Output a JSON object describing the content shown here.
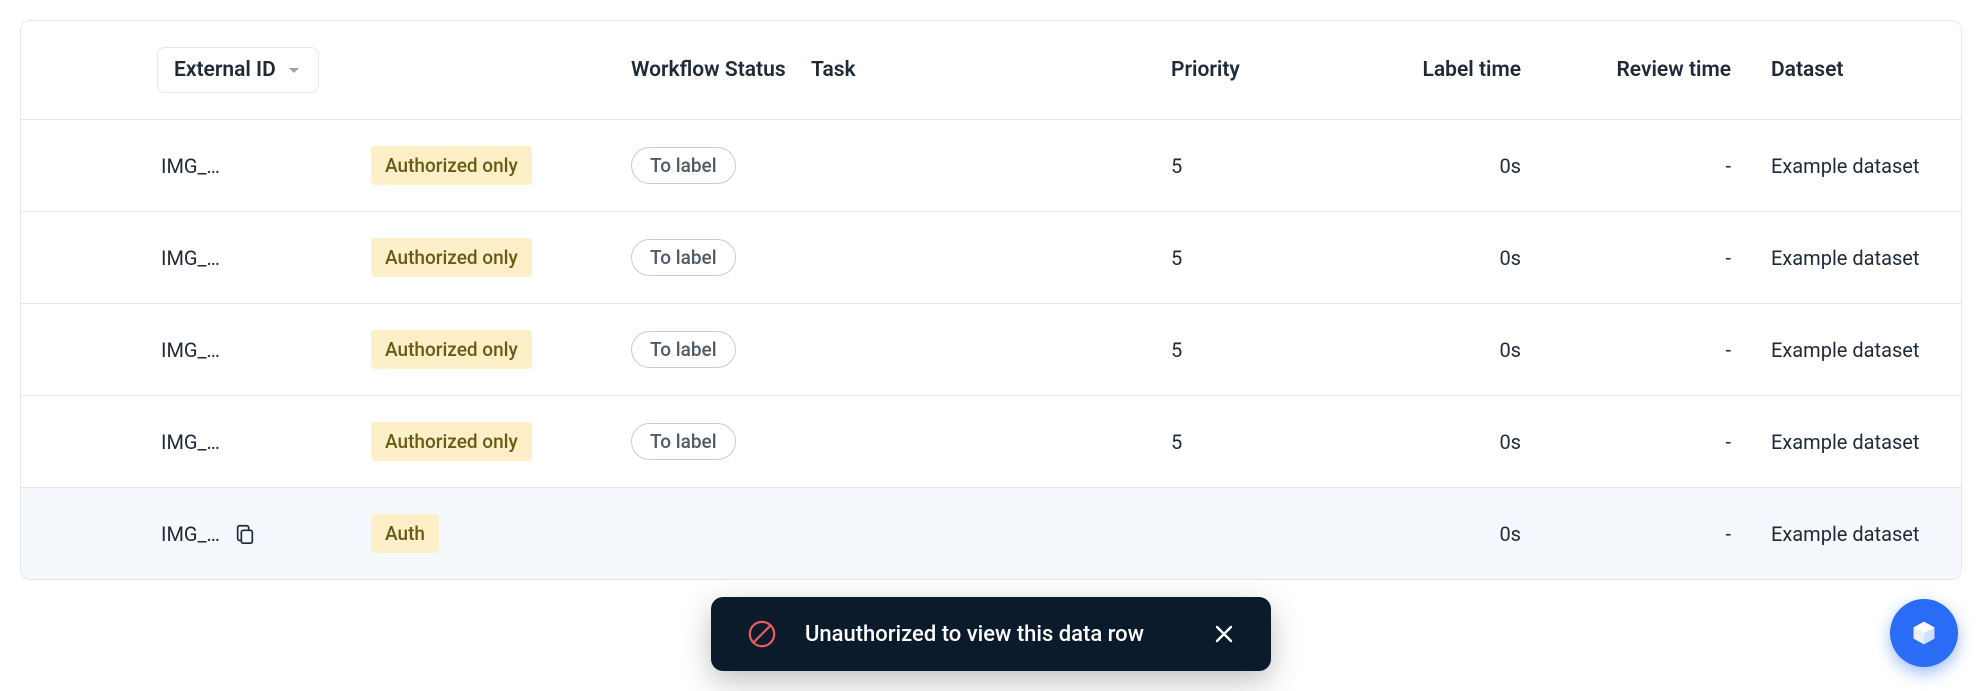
{
  "table": {
    "columns": {
      "externalId": "External ID",
      "workflowStatus": "Workflow Status",
      "task": "Task",
      "priority": "Priority",
      "labelTime": "Label time",
      "reviewTime": "Review time",
      "dataset": "Dataset"
    },
    "rows": [
      {
        "externalId": "IMG_…",
        "authChip": "Authorized only",
        "workflowStatus": "To label",
        "task": "",
        "priority": "5",
        "labelTime": "0s",
        "reviewTime": "-",
        "dataset": "Example dataset",
        "showCopy": false,
        "highlight": false
      },
      {
        "externalId": "IMG_…",
        "authChip": "Authorized only",
        "workflowStatus": "To label",
        "task": "",
        "priority": "5",
        "labelTime": "0s",
        "reviewTime": "-",
        "dataset": "Example dataset",
        "showCopy": false,
        "highlight": false
      },
      {
        "externalId": "IMG_…",
        "authChip": "Authorized only",
        "workflowStatus": "To label",
        "task": "",
        "priority": "5",
        "labelTime": "0s",
        "reviewTime": "-",
        "dataset": "Example dataset",
        "showCopy": false,
        "highlight": false
      },
      {
        "externalId": "IMG_…",
        "authChip": "Authorized only",
        "workflowStatus": "To label",
        "task": "",
        "priority": "5",
        "labelTime": "0s",
        "reviewTime": "-",
        "dataset": "Example dataset",
        "showCopy": false,
        "highlight": false
      },
      {
        "externalId": "IMG_…",
        "authChip": "Auth",
        "workflowStatus": "",
        "task": "",
        "priority": "",
        "labelTime": "0s",
        "reviewTime": "-",
        "dataset": "Example dataset",
        "showCopy": true,
        "highlight": true
      }
    ]
  },
  "toast": {
    "message": "Unauthorized to view this data row"
  }
}
